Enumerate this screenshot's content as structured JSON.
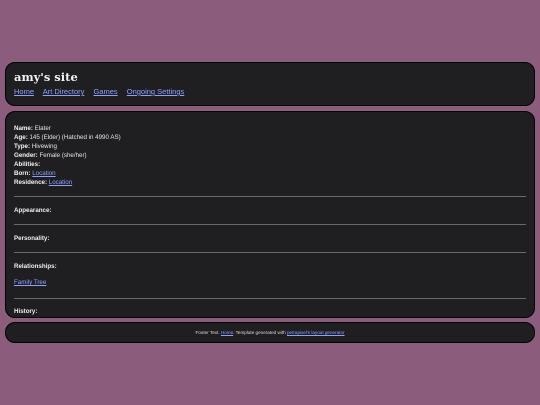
{
  "header": {
    "title": "amy's site",
    "nav": [
      "Home",
      "Art Directory",
      "Games",
      "Ongoing Settings"
    ]
  },
  "profile": {
    "name_label": "Name:",
    "name_value": "Elater",
    "age_label": "Age:",
    "age_value": "145 (Elder) (Hatched in 4990 AS)",
    "type_label": "Type:",
    "type_value": "Hivewing",
    "gender_label": "Gender:",
    "gender_value": "Female (she/her)",
    "abilities_label": "Abilities:",
    "born_label": "Born:",
    "born_link": "Location",
    "residence_label": "Residence:",
    "residence_link": "Location"
  },
  "sections": {
    "appearance": "Appearance:",
    "personality": "Personality:",
    "relationships": "Relationships:",
    "family_tree_link": "Family Tree",
    "history": "History:"
  },
  "footer": {
    "prefix": "Footer Text.",
    "home_link": "Home",
    "middle": ". Template generated with",
    "generator_link": "petrapixel's layout generator"
  },
  "colors": {
    "background": "#8c5c7c",
    "panel": "#1f1e21",
    "link": "#8ea3ff"
  }
}
